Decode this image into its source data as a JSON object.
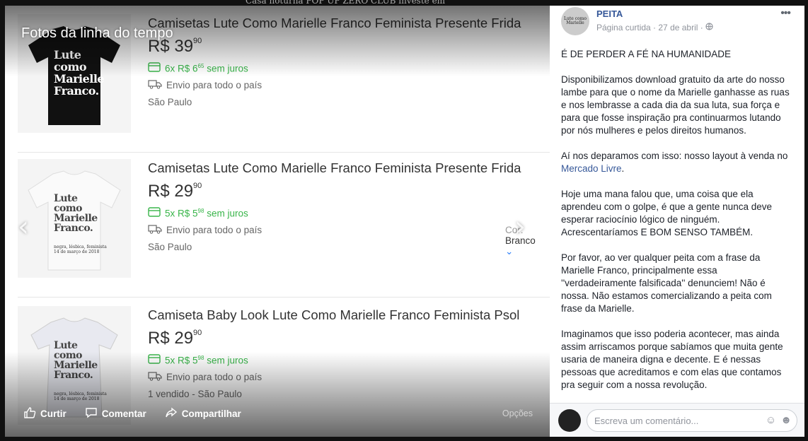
{
  "viewer": {
    "album_title": "Fotos da linha do tempo",
    "background_headline": "Casa noturna POP UP ZERO CLUB investe em"
  },
  "products": [
    {
      "title": "Camisetas Lute Como Marielle Franco Feminista Presente Frida",
      "price_main": "R$ 39",
      "price_cents": "90",
      "installments_prefix": "6x R$ 6",
      "installments_cents": "65",
      "installments_suffix": " sem juros",
      "shipping": "Envio para todo o país",
      "location": "São Paulo",
      "shirt_color": "black",
      "shirt_text": [
        "Lute",
        "como",
        "Marielle",
        "Franco."
      ]
    },
    {
      "title": "Camisetas Lute Como Marielle Franco Feminista Presente Frida",
      "price_main": "R$ 29",
      "price_cents": "90",
      "installments_prefix": "5x R$ 5",
      "installments_cents": "98",
      "installments_suffix": " sem juros",
      "shipping": "Envio para todo o país",
      "location": "São Paulo",
      "color_label": "Cor:",
      "color_value": "Branco",
      "shirt_color": "white",
      "shirt_text": [
        "Lute",
        "como",
        "Marielle",
        "Franco."
      ]
    },
    {
      "title": "Camiseta Baby Look Lute Como Marielle Franco Feminista Psol",
      "price_main": "R$ 29",
      "price_cents": "90",
      "installments_prefix": "5x R$ 5",
      "installments_cents": "98",
      "installments_suffix": " sem juros",
      "shipping": "Envio para todo o país",
      "location": "1 vendido - São Paulo",
      "shirt_color": "white",
      "shirt_text": [
        "Lute",
        "como",
        "Marielle",
        "Franco."
      ]
    }
  ],
  "shirt_small_text": [
    "negra, lésbica, feminista",
    "14 de março de 2018"
  ],
  "actions": {
    "like": "Curtir",
    "comment": "Comentar",
    "share": "Compartilhar",
    "options": "Opções"
  },
  "post": {
    "page_name": "PEITA",
    "meta": "Página curtida · 27 de abril ·",
    "avatar_text": "Lute como Marielle",
    "paragraphs": [
      "É DE PERDER A FÉ NA HUMANIDADE",
      "Disponibilizamos download gratuito da arte do nosso lambe para que o nome da Marielle ganhasse as ruas e nos lembrasse a cada dia da sua luta, sua força e para que fosse inspiração pra continuarmos lutando por nós mulheres e pelos direitos humanos.",
      "Hoje uma mana falou que, uma coisa que ela aprendeu com o golpe, é que a gente nunca deve esperar raciocínio lógico de ninguém. Acrescentaríamos E BOM SENSO TAMBÉM.",
      "Por favor, ao ver qualquer peita com a frase da Marielle Franco, principalmente essa ''verdadeiramente falsificada'' denunciem! Não é nossa. Não estamos comercializando a peita com frase da Marielle.",
      "Imaginamos que isso poderia acontecer, mas ainda assim arriscamos porque sabíamos que muita gente usaria de maneira digna e decente. E é nessas pessoas que acreditamos e com elas que contamos pra seguir com a nossa revolução."
    ],
    "market_prefix": "Aí nos deparamos com isso: nosso layout à venda no ",
    "market_link": "Mercado Livre",
    "market_suffix": ".",
    "comment_placeholder": "Escreva um comentário..."
  },
  "colors": {
    "green": "#39b54a",
    "link": "#365899",
    "accent_blue": "#3483fa"
  }
}
